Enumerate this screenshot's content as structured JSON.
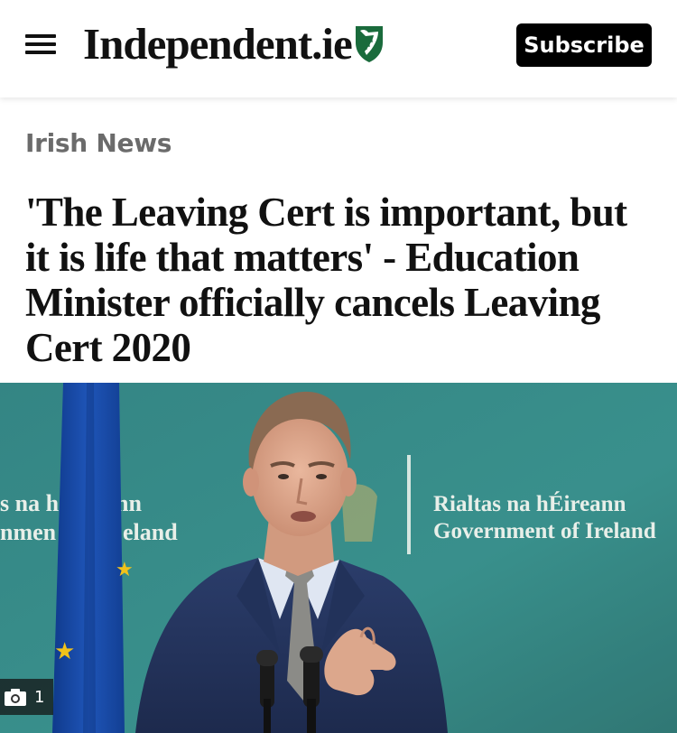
{
  "header": {
    "brand_name": "Independent.ie",
    "subscribe_label": "Subscribe"
  },
  "article": {
    "section": "Irish News",
    "headline": "'The Leaving Cert is important, but it is life that matters' - Education Minister officially cancels Leaving Cert 2020",
    "hero_image": {
      "photo_count": "1",
      "sign_left_line1": "s na h",
      "sign_left_line2": "nmen",
      "sign_mid_line1": "nn",
      "sign_mid_line2": "eland",
      "sign_right_line1": "Rialtas na hÉireann",
      "sign_right_line2": "Government of Ireland"
    }
  },
  "colors": {
    "brand_harp": "#1a6b3c",
    "backdrop": "#2f8a86",
    "subscribe_bg": "#000000",
    "section_label": "#6b6b6b"
  },
  "icons": {
    "menu": "hamburger-icon",
    "logo": "harp-shield-icon",
    "photo": "camera-icon"
  }
}
